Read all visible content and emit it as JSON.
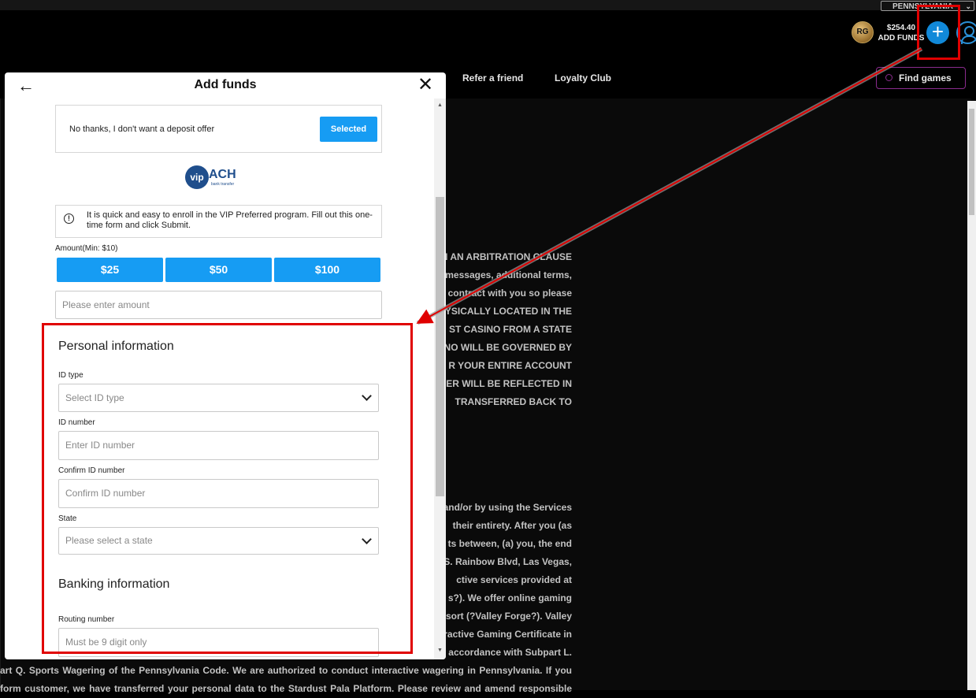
{
  "header": {
    "state": "PENNSYLVANIA",
    "balance": "$254.40",
    "add_funds_label": "ADD FUNDS",
    "coin_label": "RG"
  },
  "nav": {
    "refer": "Refer a friend",
    "loyalty": "Loyalty Club",
    "find_games": "Find games"
  },
  "terms": {
    "block1": [
      "N AN ARBITRATION CLAUSE",
      "messages, additional terms,",
      "contract with you so please",
      "YSICALLY LOCATED IN THE",
      "ST CASINO FROM A STATE",
      "NO WILL BE GOVERNED BY",
      "R YOUR ENTIRE ACCOUNT",
      "FER WILL BE REFLECTED IN",
      "TRANSFERRED BACK TO"
    ],
    "block2": [
      "and/or by using the Services",
      "their entirety. After you (as",
      "ts between, (a) you, the end",
      "S. Rainbow Blvd, Las Vegas,",
      "ctive services provided at",
      "s?). We offer online gaming",
      "sort (?Valley Forge?). Valley",
      "ractive Gaming Certificate in",
      "accordance with Subpart L.",
      "art Q. Sports Wagering of the Pennsylvania Code. We are authorized to conduct interactive wagering in Pennsylvania. If you",
      "form customer, we have transferred your personal data to the Stardust Pala Platform. Please review and amend responsible"
    ]
  },
  "modal": {
    "title": "Add funds",
    "no_offer_text": "No thanks, I don't want a deposit offer",
    "selected_label": "Selected",
    "vip_logo": {
      "vip": "vip",
      "ach": "ACH",
      "sub": "bank transfer"
    },
    "info_text": "It is quick and easy to enroll in the VIP Preferred program. Fill out this one-time form and click Submit.",
    "amount_label": "Amount(Min: $10)",
    "amount_buttons": [
      "$25",
      "$50",
      "$100"
    ],
    "amount_placeholder": "Please enter amount",
    "personal_heading": "Personal information",
    "id_type_label": "ID type",
    "id_type_placeholder": "Select ID type",
    "id_number_label": "ID number",
    "id_number_placeholder": "Enter ID number",
    "confirm_id_label": "Confirm ID number",
    "confirm_id_placeholder": "Confirm ID number",
    "state_label": "State",
    "state_placeholder": "Please select a state",
    "banking_heading": "Banking information",
    "routing_label": "Routing number",
    "routing_placeholder": "Must be 9 digit only"
  },
  "colors": {
    "accent_blue": "#169cf3",
    "highlight_red": "#e00000",
    "find_games_border": "#8a2b8e"
  }
}
